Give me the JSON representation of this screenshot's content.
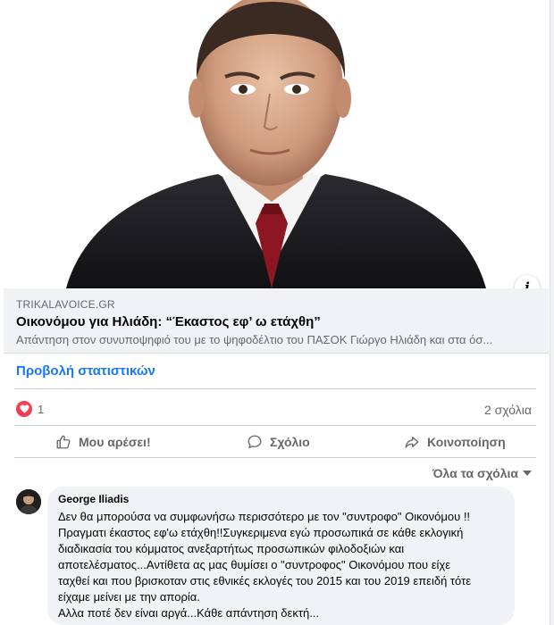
{
  "link_preview": {
    "domain": "TRIKALAVOICE.GR",
    "title": "Οικονόμου για Ηλιάδη: “Έκαστος εφ’ ω ετάχθη”",
    "description": "Απάντηση στον συνυποψηφιό του με το ψηφοδέλτιο του ΠΑΣΟΚ Γιώργο Ηλιάδη και στα όσ..."
  },
  "stats_link": "Προβολή στατιστικών",
  "reactions": {
    "count": "1",
    "comments": "2 σχόλια",
    "heart_color": "#f33e58"
  },
  "actions": {
    "like": "Μου αρέσει!",
    "comment": "Σχόλιο",
    "share": "Κοινοποίηση"
  },
  "comments_sort": "Όλα τα σχόλια",
  "comment": {
    "author": "George Iliadis",
    "lines": [
      "Δεν θα μπορούσα να συμφωνήσω περισσότερο με τον \"συντροφο\" Οικονόμου !!",
      "Πραγματι έκαστος εφ'ω ετάχθη!!Συγκεριμενα εγώ προσωπικά σε κάθε εκλογική",
      "διαδικασία του κόμματος ανεξαρτήτως προσωπικών φιλοδοξιών και",
      "αποτελέσματος...Αντίθετα ας μας θυμίσει ο \"συντροφος\" Οικονόμου που είχε",
      "ταχθεί και που βρισκοταν στις εθνικές εκλογές του 2015 και του 2019 επειδή τότε",
      "είχαμε μείνει με την απορία.",
      "Αλλα ποτέ δεν είναι αργά...Κάθε απάντηση δεκτή..."
    ]
  },
  "colors": {
    "accent": "#1877f2",
    "muted": "#65676b",
    "bubble": "#f0f2f5"
  }
}
